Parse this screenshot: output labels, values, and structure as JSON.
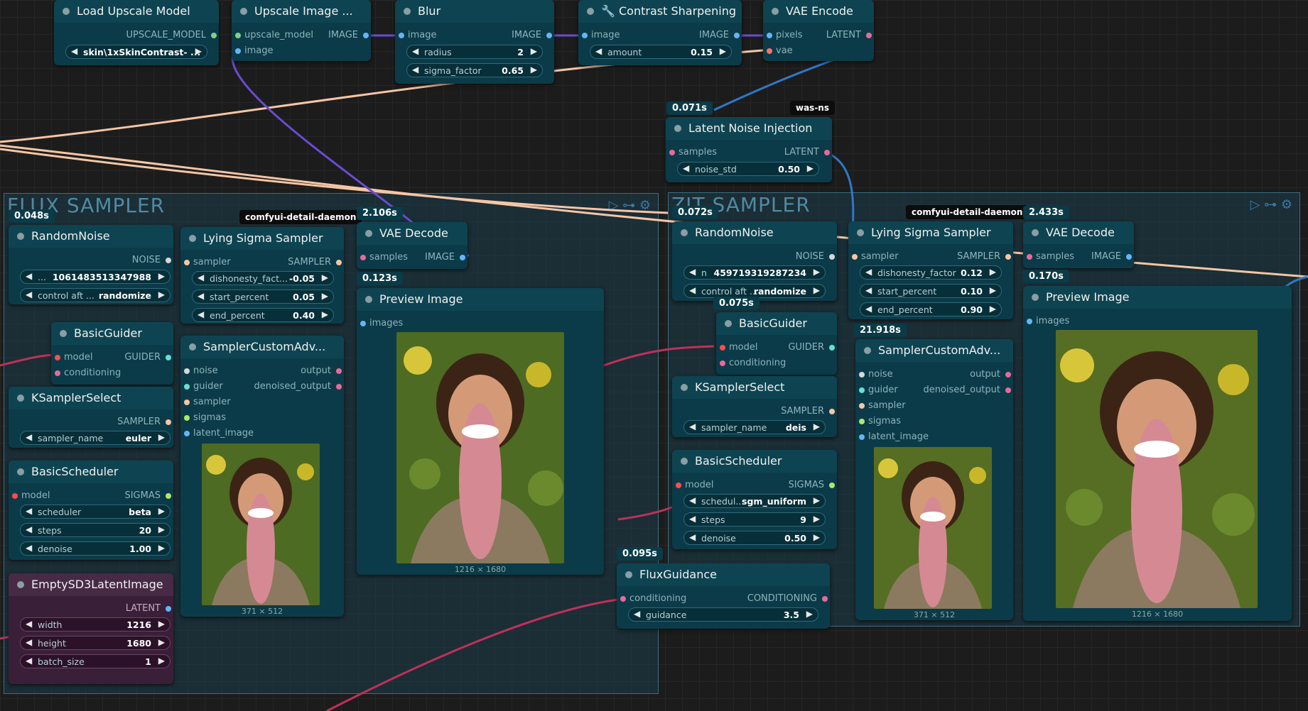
{
  "groups": {
    "flux_title": "FLUX SAMPLER",
    "zit_title": "ZIT SAMPLER"
  },
  "top_chain": {
    "load_upscale": {
      "title": "Load Upscale Model",
      "out": "UPSCALE_MODEL",
      "model_name": "skin\\1xSkinContrast- ..."
    },
    "upscale_image": {
      "title": "Upscale Image ...",
      "in1": "upscale_model",
      "in2": "image",
      "out": "IMAGE"
    },
    "blur": {
      "title": "Blur",
      "in": "image",
      "out": "IMAGE",
      "radius_label": "radius",
      "radius": "2",
      "sigma_label": "sigma_factor",
      "sigma": "0.65"
    },
    "contrast": {
      "title": "🔧 Contrast Sharpening",
      "in": "image",
      "out": "IMAGE",
      "amount_label": "amount",
      "amount": "0.15"
    },
    "vae_encode": {
      "title": "VAE Encode",
      "in1": "pixels",
      "in2": "vae",
      "out": "LATENT"
    }
  },
  "latent_noise": {
    "time": "0.071s",
    "tag": "was-ns",
    "title": "Latent Noise Injection",
    "in": "samples",
    "out": "LATENT",
    "noise_label": "noise_std",
    "noise": "0.50"
  },
  "flux": {
    "time_group": "0.048s",
    "random_noise": {
      "title": "RandomNoise",
      "out": "NOISE",
      "seed": "1061483513347988",
      "seed_prefix": "...",
      "control_label": "control aft ...",
      "control": "randomize"
    },
    "lying": {
      "tag": "comfyui-detail-daemon",
      "title": "Lying Sigma Sampler",
      "in": "sampler",
      "out": "SAMPLER",
      "w1_label": "dishonesty_fact...",
      "w1": "-0.05",
      "w2_label": "start_percent",
      "w2": "0.05",
      "w3_label": "end_percent",
      "w3": "0.40"
    },
    "vae_decode": {
      "time": "2.106s",
      "title": "VAE Decode",
      "in": "samples",
      "out": "IMAGE"
    },
    "preview": {
      "time": "0.123s",
      "title": "Preview Image",
      "in": "images",
      "caption": "1216 × 1680"
    },
    "basic_guider": {
      "title": "BasicGuider",
      "in1": "model",
      "in2": "conditioning",
      "out": "GUIDER"
    },
    "sampler_adv": {
      "title": "SamplerCustomAdv...",
      "in1": "noise",
      "in2": "guider",
      "in3": "sampler",
      "in4": "sigmas",
      "in5": "latent_image",
      "out1": "output",
      "out2": "denoised_output",
      "caption": "371 × 512"
    },
    "ksampler_select": {
      "title": "KSamplerSelect",
      "out": "SAMPLER",
      "w_label": "sampler_name",
      "w": "euler"
    },
    "scheduler": {
      "title": "BasicScheduler",
      "in": "model",
      "out": "SIGMAS",
      "w1_label": "scheduler",
      "w1": "beta",
      "w2_label": "steps",
      "w2": "20",
      "w3_label": "denoise",
      "w3": "1.00"
    },
    "empty_latent": {
      "title": "EmptySD3LatentImage",
      "out": "LATENT",
      "w1_label": "width",
      "w1": "1216",
      "w2_label": "height",
      "w2": "1680",
      "w3_label": "batch_size",
      "w3": "1"
    }
  },
  "zit": {
    "time_group": "0.072s",
    "random_noise": {
      "title": "RandomNoise",
      "out": "NOISE",
      "seed": "459719319287234",
      "seed_prefix": "n",
      "control_label": "control aft ...",
      "control": "randomize"
    },
    "lying": {
      "tag": "comfyui-detail-daemon",
      "title": "Lying Sigma Sampler",
      "in": "sampler",
      "out": "SAMPLER",
      "w1_label": "dishonesty_factor",
      "w1": "0.12",
      "w2_label": "start_percent",
      "w2": "0.10",
      "w3_label": "end_percent",
      "w3": "0.90"
    },
    "vae_decode": {
      "time": "2.433s",
      "title": "VAE Decode",
      "in": "samples",
      "out": "IMAGE"
    },
    "preview": {
      "time": "0.170s",
      "title": "Preview Image",
      "in": "images",
      "caption": "1216 × 1680"
    },
    "basic_guider": {
      "time": "0.075s",
      "title": "BasicGuider",
      "in1": "model",
      "in2": "conditioning",
      "out": "GUIDER"
    },
    "sampler_adv": {
      "time": "21.918s",
      "title": "SamplerCustomAdv...",
      "in1": "noise",
      "in2": "guider",
      "in3": "sampler",
      "in4": "sigmas",
      "in5": "latent_image",
      "out1": "output",
      "out2": "denoised_output",
      "caption": "371 × 512"
    },
    "ksampler_select": {
      "title": "KSamplerSelect",
      "out": "SAMPLER",
      "w_label": "sampler_name",
      "w": "deis"
    },
    "scheduler": {
      "title": "BasicScheduler",
      "in": "model",
      "out": "SIGMAS",
      "w1_label": "schedul...",
      "w1": "sgm_uniform",
      "w2_label": "steps",
      "w2": "9",
      "w3_label": "denoise",
      "w3": "0.50"
    }
  },
  "flux_guidance": {
    "time": "0.095s",
    "title": "FluxGuidance",
    "in": "conditioning",
    "out": "CONDITIONING",
    "w_label": "guidance",
    "w": "3.5"
  },
  "colors": {
    "latent": "#e86a9a",
    "image": "#64b5f6",
    "model": "#b39ddb",
    "clip": "#ffd500",
    "vae": "#ff6e6e",
    "conditioning": "#ffa931"
  }
}
